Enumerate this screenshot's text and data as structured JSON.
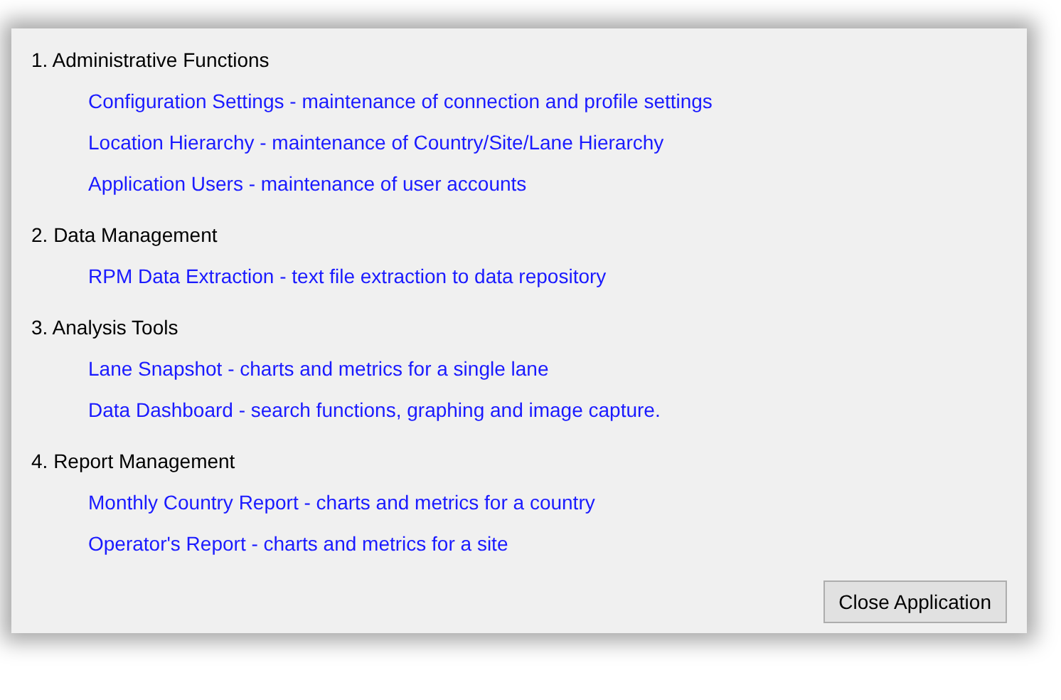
{
  "sections": [
    {
      "heading": "1. Administrative Functions",
      "links": [
        "Configuration Settings - maintenance of connection and profile settings",
        "Location Hierarchy - maintenance of Country/Site/Lane Hierarchy",
        "Application Users - maintenance of user accounts"
      ]
    },
    {
      "heading": "2. Data Management",
      "links": [
        "RPM Data Extraction - text file extraction to data repository"
      ]
    },
    {
      "heading": "3. Analysis Tools",
      "links": [
        "Lane Snapshot - charts and metrics for a single lane",
        "Data Dashboard - search functions, graphing and image capture."
      ]
    },
    {
      "heading": "4. Report Management",
      "links": [
        "Monthly Country Report - charts and metrics for a country",
        "Operator's Report - charts and metrics for a site"
      ]
    }
  ],
  "buttons": [
    "Close Application"
  ]
}
